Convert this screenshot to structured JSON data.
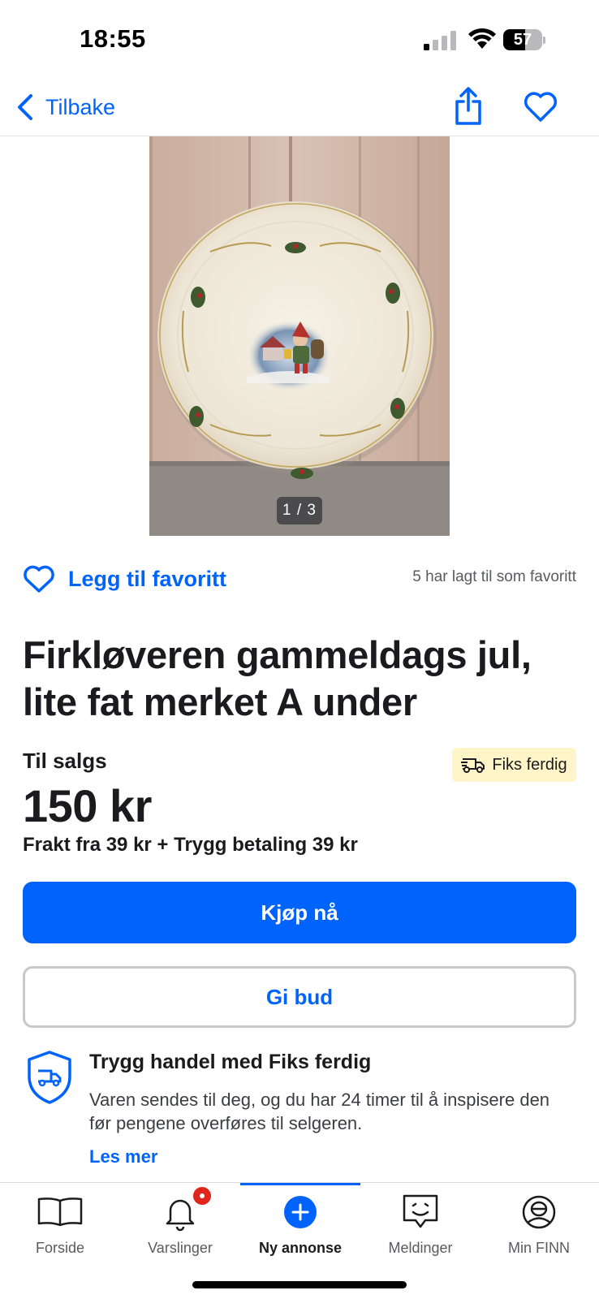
{
  "status_bar": {
    "time": "18:55",
    "battery_percent": "57",
    "battery_level": 0.57
  },
  "nav": {
    "back_label": "Tilbake",
    "share_icon": "share-icon",
    "favorite_icon": "heart-outline-icon"
  },
  "gallery": {
    "counter": "1 / 3",
    "current": 1,
    "total": 3
  },
  "favorite": {
    "action_label": "Legg til favoritt",
    "count_text": "5 har lagt til som favoritt"
  },
  "listing": {
    "title": "Firkløveren gammeldags jul, lite fat merket A under",
    "status": "Til salgs",
    "price": "150 kr",
    "shipping": "Frakt fra 39 kr + Trygg betaling 39 kr",
    "badge_label": "Fiks ferdig"
  },
  "actions": {
    "buy_label": "Kjøp nå",
    "bid_label": "Gi bud"
  },
  "safe_trade": {
    "title": "Trygg handel med Fiks ferdig",
    "text": "Varen sendes til deg, og du har 24 timer til å inspisere den før pengene overføres til selgeren.",
    "link": "Les mer"
  },
  "tabs": [
    {
      "label": "Forside",
      "icon": "book-icon",
      "active": false
    },
    {
      "label": "Varslinger",
      "icon": "bell-icon",
      "active": false
    },
    {
      "label": "Ny annonse",
      "icon": "plus-circle-icon",
      "active": true
    },
    {
      "label": "Meldinger",
      "icon": "chat-icon",
      "active": false
    },
    {
      "label": "Min FINN",
      "icon": "profile-icon",
      "active": false
    }
  ],
  "colors": {
    "accent": "#0063fb",
    "badge_bg": "#fff5c8",
    "notification": "#e0251b"
  }
}
